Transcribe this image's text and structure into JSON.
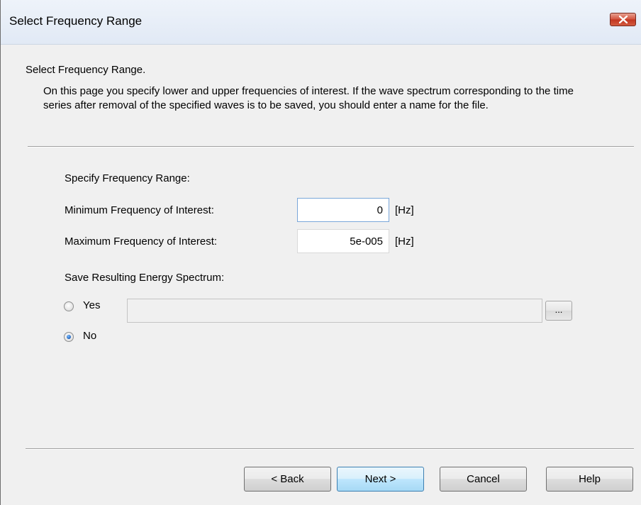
{
  "window": {
    "title": "Select Frequency Range"
  },
  "page": {
    "heading": "Select Frequency Range.",
    "description": "On this page you specify lower and upper frequencies of interest. If the wave spectrum corresponding to the time series after removal of the specified waves is to be saved, you should enter a name for the file."
  },
  "range": {
    "section_label": "Specify Frequency Range:",
    "min_label": "Minimum Frequency of Interest:",
    "min_value": "0",
    "min_unit": "[Hz]",
    "max_label": "Maximum Frequency of Interest:",
    "max_value": "5e-005",
    "max_unit": "[Hz]"
  },
  "save": {
    "section_label": "Save Resulting Energy Spectrum:",
    "yes_label": "Yes",
    "no_label": "No",
    "selected": "No",
    "file_value": "",
    "browse_label": "..."
  },
  "buttons": {
    "back": "< Back",
    "next": "Next >",
    "cancel": "Cancel",
    "help": "Help"
  }
}
